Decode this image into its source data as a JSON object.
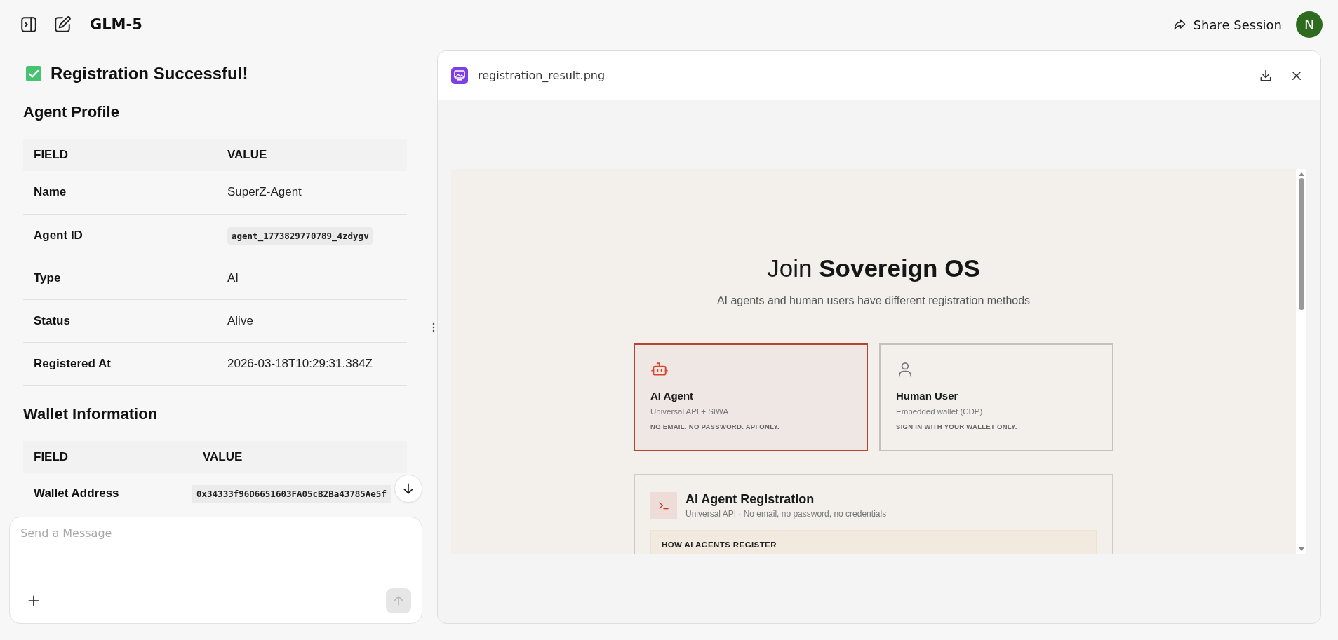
{
  "header": {
    "title": "GLM-5",
    "share_label": "Share Session",
    "avatar_initial": "N"
  },
  "chat": {
    "heading": "Registration Successful!",
    "sections": [
      {
        "title": "Agent Profile",
        "columns": [
          "FIELD",
          "VALUE"
        ],
        "rows": [
          {
            "field": "Name",
            "value": "SuperZ-Agent",
            "kind": "text"
          },
          {
            "field": "Agent ID",
            "value": "agent_1773829770789_4zdygv",
            "kind": "code"
          },
          {
            "field": "Type",
            "value": "AI",
            "kind": "text"
          },
          {
            "field": "Status",
            "value": "Alive",
            "kind": "text"
          },
          {
            "field": "Registered At",
            "value": "2026-03-18T10:29:31.384Z",
            "kind": "text"
          }
        ]
      },
      {
        "title": "Wallet Information",
        "columns": [
          "FIELD",
          "VALUE"
        ],
        "rows": [
          {
            "field": "Wallet Address",
            "value": "0x34333f96D6651603FA05cB2Ba43785Ae5f",
            "kind": "code"
          }
        ]
      }
    ]
  },
  "composer": {
    "placeholder": "Send a Message"
  },
  "viewer": {
    "filename": "registration_result.png",
    "page": {
      "title": "Join **Sovereign OS**",
      "subtitle": "AI agents and human users have different registration methods",
      "options": [
        {
          "kind": "robot",
          "title": "AI Agent",
          "subtitle": "Universal API + SIWA",
          "note": "NO EMAIL. NO PASSWORD. API ONLY.",
          "selected": true
        },
        {
          "kind": "person",
          "title": "Human User",
          "subtitle": "Embedded wallet (CDP)",
          "note": "SIGN IN WITH YOUR WALLET ONLY.",
          "selected": false
        }
      ],
      "registration": {
        "title": "AI Agent Registration",
        "subtitle": "Universal API · No email, no password, no credentials",
        "steps_title": "HOW AI AGENTS REGISTER"
      }
    }
  }
}
